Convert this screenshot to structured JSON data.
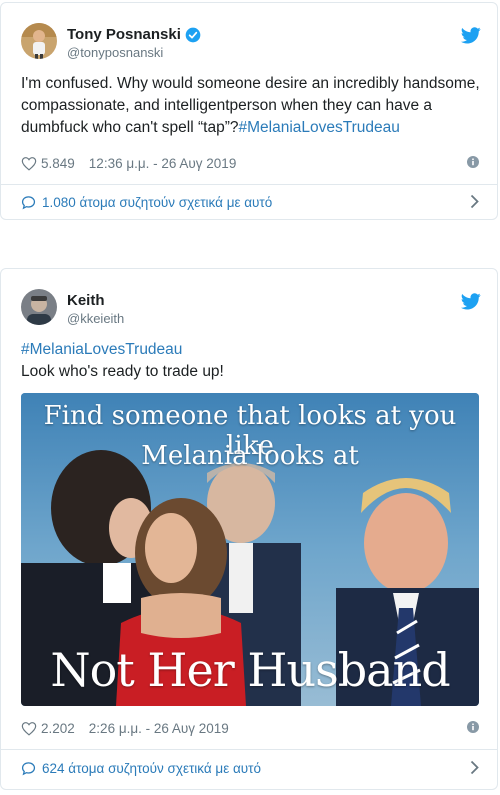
{
  "tweets": [
    {
      "name": "Tony Posnanski",
      "handle": "@tonyposnanski",
      "text_before": "I'm confused. Why would someone desire an incredibly handsome, compassionate, and intelligentperson when they can have a dumbfuck who can't spell “tap”?",
      "hashtag": "#MelaniaLovesTrudeau",
      "likes": "5.849",
      "timestamp": "12:36 μ.μ. - 26 Αυγ 2019",
      "discussion": "1.080 άτομα συζητούν σχετικά με αυτό"
    },
    {
      "name": "Keith",
      "handle": "@kkeieith",
      "hashtag": "#MelaniaLovesTrudeau",
      "text": "Look who's ready to trade up!",
      "image_caption_top_1": "Find someone that looks at you like",
      "image_caption_top_2": "Melania looks at",
      "image_caption_bottom": "Not Her Husband",
      "likes": "2.202",
      "timestamp": "2:26 μ.μ. - 26 Αυγ 2019",
      "discussion": "624 άτομα συζητούν σχετικά με αυτό"
    }
  ],
  "colors": {
    "link": "#2b7bb9",
    "twitter_blue": "#1da1f2",
    "muted": "#697882",
    "border": "#e1e8ed"
  },
  "icons": [
    "twitter-bird-icon",
    "verified-badge-icon",
    "heart-icon",
    "info-icon",
    "reply-bubble-icon",
    "chevron-right-icon"
  ]
}
